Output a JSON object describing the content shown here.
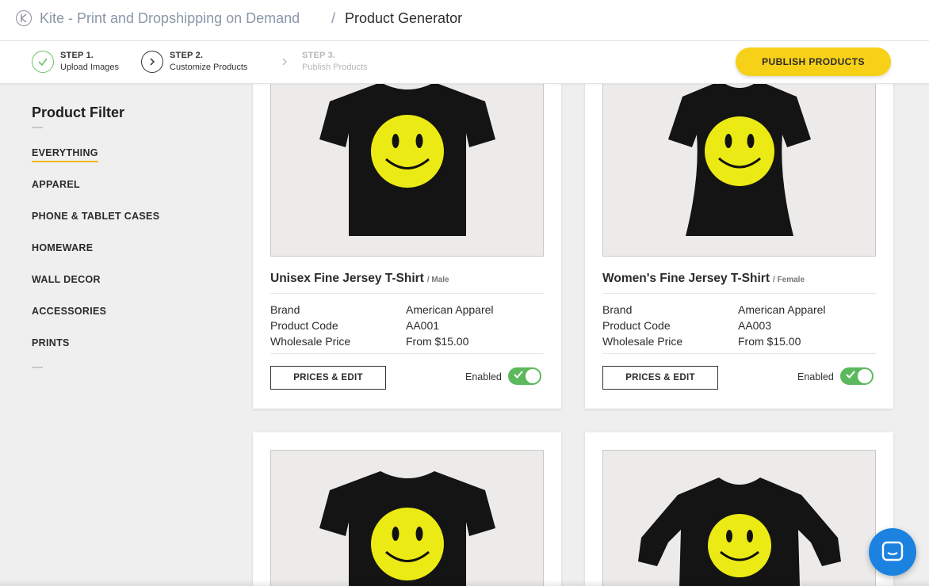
{
  "breadcrumb": {
    "app_title": "Kite - Print and Dropshipping on Demand",
    "separator": "/",
    "page_title": "Product Generator"
  },
  "steps": [
    {
      "number": "STEP 1.",
      "label": "Upload Images",
      "state": "done"
    },
    {
      "number": "STEP 2.",
      "label": "Customize Products",
      "state": "current"
    },
    {
      "number": "STEP 3.",
      "label": "Publish Products",
      "state": "future"
    }
  ],
  "publish_button": "PUBLISH PRODUCTS",
  "filter": {
    "title": "Product Filter",
    "items": [
      "EVERYTHING",
      "APPAREL",
      "PHONE & TABLET CASES",
      "HOMEWARE",
      "WALL DECOR",
      "ACCESSORIES",
      "PRINTS"
    ],
    "active": "EVERYTHING"
  },
  "products": [
    {
      "name": "Unisex Fine Jersey T-Shirt",
      "gender": "/ Male",
      "specs": [
        {
          "label": "Brand",
          "value": "American Apparel"
        },
        {
          "label": "Product Code",
          "value": "AA001"
        },
        {
          "label": "Wholesale Price",
          "value": "From $15.00"
        }
      ],
      "edit_label": "PRICES & EDIT",
      "enabled_label": "Enabled",
      "enabled": true
    },
    {
      "name": "Women's Fine Jersey T-Shirt",
      "gender": "/ Female",
      "specs": [
        {
          "label": "Brand",
          "value": "American Apparel"
        },
        {
          "label": "Product Code",
          "value": "AA003"
        },
        {
          "label": "Wholesale Price",
          "value": "From $15.00"
        }
      ],
      "edit_label": "PRICES & EDIT",
      "enabled_label": "Enabled",
      "enabled": true
    }
  ],
  "colors": {
    "accent_yellow": "#f7d117",
    "toggle_green": "#5cb85c",
    "step_done_green": "#6fc06a",
    "chat_blue": "#1b82e0"
  },
  "icons": {
    "logo": "kite-logo-icon",
    "step_done": "check-circle-icon",
    "step_current": "chevron-circle-icon",
    "step_future": "chevron-right-icon",
    "chat": "chat-icon"
  }
}
